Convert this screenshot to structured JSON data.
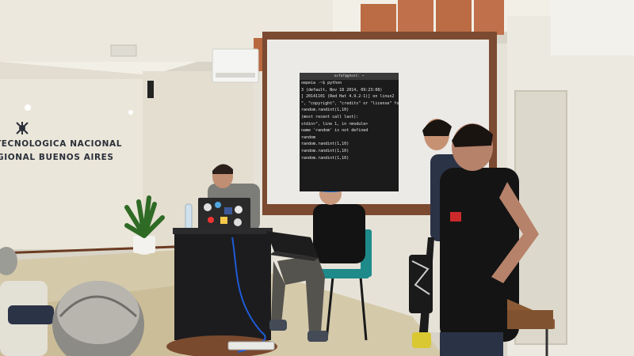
{
  "wall_sign": {
    "line1": "TECNOLOGICA NACIONAL",
    "line2": "GIONAL BUENOS AIRES"
  },
  "terminal": {
    "title": "ovfaf@ghost: ~",
    "lines": [
      "oepeia -~$ python",
      "3 (default, Nov 18 2014, 09:23:08)",
      "] 20141101 (Red Hat 4.9.2-1)] on linux2",
      "\", \"copyright\", \"credits\" or \"license\" for more inform",
      "random.randint(1,10)",
      "(most recent call last):",
      "stdin>\", line 1, in <module>",
      "name 'random' is not defined",
      "random",
      "random.randint(1,10)",
      "",
      "random.randint(1,10)",
      "",
      "random.randint(1,10)"
    ]
  },
  "colors": {
    "wall": "#e7e2d6",
    "ceiling": "#f1eee6",
    "screen": "#e9e8e6",
    "terminal_bg": "#1b1b1b",
    "hat": "#1d6fd8",
    "podium": "#1c1c1e"
  }
}
